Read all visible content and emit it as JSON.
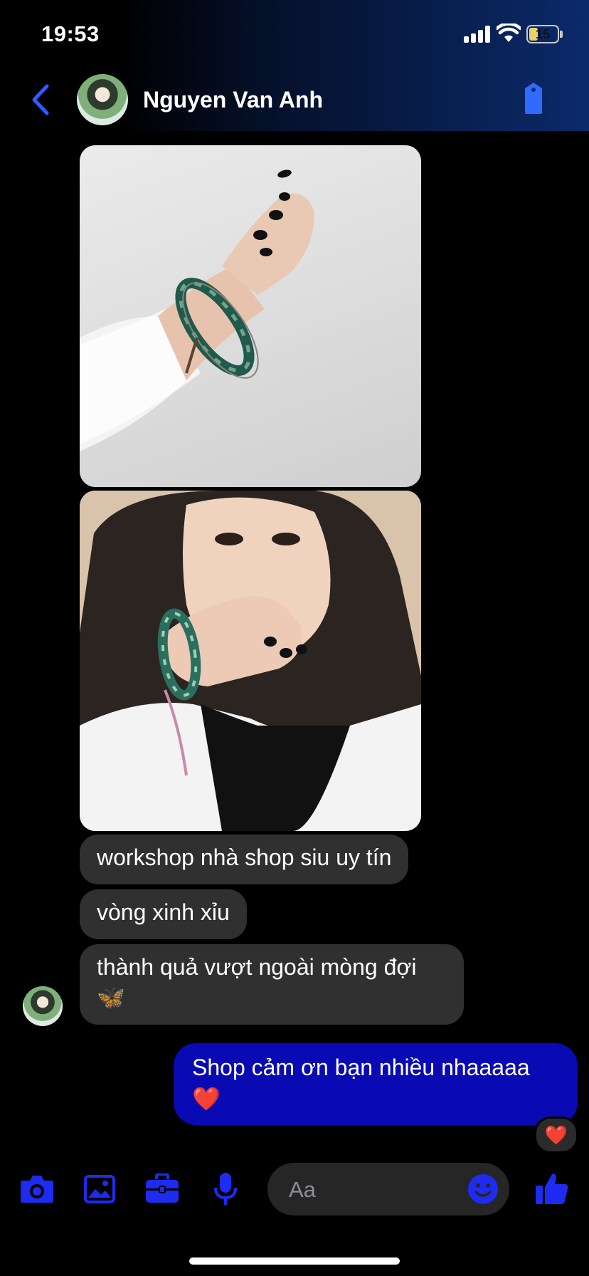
{
  "status_bar": {
    "time": "19:53",
    "battery": "15"
  },
  "header": {
    "contact_name": "Nguyen Van Anh"
  },
  "messages": {
    "incoming": [
      {
        "text": "workshop nhà shop siu uy tín"
      },
      {
        "text": "vòng xinh xỉu"
      },
      {
        "text": "thành quả vượt ngoài mòng đợi",
        "emoji": "🦋"
      }
    ],
    "outgoing": [
      {
        "text": "Shop cảm ơn bạn nhiều nhaaaaa",
        "emoji": "❤️"
      }
    ],
    "reaction": "❤️"
  },
  "composer": {
    "placeholder": "Aa"
  },
  "colors": {
    "accent": "#0a0ab4",
    "incoming_bubble": "#303030",
    "icon_blue": "#1d2cf0"
  }
}
